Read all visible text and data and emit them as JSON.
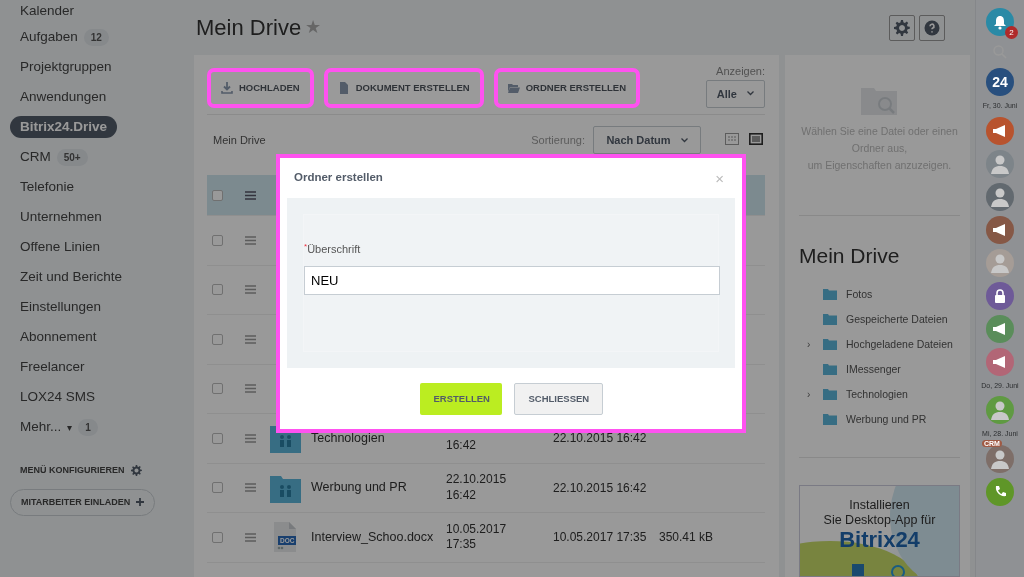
{
  "sidebar": {
    "items": [
      {
        "label": "Kalender",
        "selected": false
      },
      {
        "label": "Aufgaben",
        "count": "12",
        "selected": false
      },
      {
        "label": "Projektgruppen",
        "selected": false
      },
      {
        "label": "Anwendungen",
        "selected": false
      },
      {
        "label": "Bitrix24.Drive",
        "selected": true
      },
      {
        "label": "CRM",
        "count": "50+",
        "selected": false
      },
      {
        "label": "Telefonie",
        "selected": false
      },
      {
        "label": "Unternehmen",
        "selected": false
      },
      {
        "label": "Offene Linien",
        "selected": false
      },
      {
        "label": "Zeit und Berichte",
        "selected": false
      },
      {
        "label": "Einstellungen",
        "selected": false
      },
      {
        "label": "Abonnement",
        "selected": false
      },
      {
        "label": "Freelancer",
        "selected": false
      },
      {
        "label": "LOX24 SMS",
        "selected": false
      },
      {
        "label": "Mehr...",
        "count": "1",
        "caret": "▾",
        "selected": false
      }
    ],
    "configure": "MENÜ KONFIGURIEREN",
    "invite": "MITARBEITER EINLADEN"
  },
  "header": {
    "title": "Mein Drive",
    "star": "★"
  },
  "toolbar": {
    "buttons": [
      {
        "kind": "upload",
        "label": "HOCHLADEN",
        "highlighted": true
      },
      {
        "kind": "document",
        "label": "DOKUMENT ERSTELLEN",
        "highlighted": true
      },
      {
        "kind": "folder",
        "label": "ORDNER ERSTELLEN",
        "highlighted": true
      }
    ],
    "filter_label": "Anzeigen:",
    "filter_value": "Alle"
  },
  "listing": {
    "breadcrumb": "Mein Drive",
    "sort_label": "Sortierung:",
    "sort_value": "Nach Datum",
    "view_options": [
      {
        "kind": "grid",
        "selected": false
      },
      {
        "kind": "list",
        "selected": true
      }
    ],
    "rows": [
      {
        "kind": "header",
        "selected": true
      },
      {
        "kind": "covered",
        "selected": false
      },
      {
        "kind": "covered",
        "selected": false
      },
      {
        "kind": "covered",
        "selected": false
      },
      {
        "kind": "covered",
        "selected": false
      },
      {
        "kind": "folder",
        "name": "Technologien",
        "created": "16:42",
        "modified": "22.10.2015 16:42",
        "selected": false
      },
      {
        "kind": "folder",
        "name": "Werbung und PR",
        "created": "22.10.2015\n16:42",
        "modified": "22.10.2015 16:42",
        "selected": false
      },
      {
        "kind": "doc",
        "badge": "DOC",
        "name": "Interview_Schoo.docx",
        "created": "10.05.2017\n17:35",
        "modified": "10.05.2017 17:35",
        "size": "350.41 kB",
        "selected": false
      }
    ]
  },
  "details": {
    "empty_text": "Wählen Sie eine Datei oder einen Ordner aus,\num Eigenschaften anzuzeigen.",
    "tree_title": "Mein Drive",
    "tree": [
      {
        "label": "Fotos"
      },
      {
        "label": "Gespeicherte Dateien"
      },
      {
        "label": "Hochgeladene Dateien",
        "toggle": "›"
      },
      {
        "label": "IMessenger"
      },
      {
        "label": "Technologien",
        "toggle": "›"
      },
      {
        "label": "Werbung und PR"
      }
    ],
    "banner": {
      "line1": "Installieren\nSie Desktop-App für",
      "line2": "Bitrix24"
    }
  },
  "right_bar": [
    {
      "kind": "bell",
      "badge": "2",
      "color": "#2a8aa6"
    },
    {
      "kind": "search"
    },
    {
      "kind": "logo",
      "label": "24",
      "color": "#284f7e"
    },
    {
      "kind": "date",
      "label": "Fr, 30. Juni"
    },
    {
      "kind": "megaphone",
      "color": "#b8532e"
    },
    {
      "kind": "avatar",
      "color": "#7d8489"
    },
    {
      "kind": "avatar",
      "color": "#62696f"
    },
    {
      "kind": "megaphone",
      "color": "#865846"
    },
    {
      "kind": "avatar",
      "color": "#a59c96"
    },
    {
      "kind": "lock",
      "color": "#6e5a98"
    },
    {
      "kind": "megaphone",
      "color": "#5a8d5a"
    },
    {
      "kind": "megaphone",
      "color": "#b26676"
    },
    {
      "kind": "date",
      "label": "Do, 29. Juni"
    },
    {
      "kind": "avatar",
      "color": "#5f9a42"
    },
    {
      "kind": "date",
      "label": "Mi, 28. Juni"
    },
    {
      "kind": "avatar",
      "color": "#7e6e68",
      "tag": "CRM"
    },
    {
      "kind": "phone",
      "color": "#5f9628"
    }
  ],
  "dialog": {
    "title": "Ordner erstellen",
    "close": "×",
    "field_label": "Überschrift",
    "required_mark": "*",
    "value": "NEU",
    "buttons": [
      {
        "kind": "primary",
        "label": "ERSTELLEN"
      },
      {
        "kind": "secondary",
        "label": "SCHLIESSEN"
      }
    ]
  }
}
